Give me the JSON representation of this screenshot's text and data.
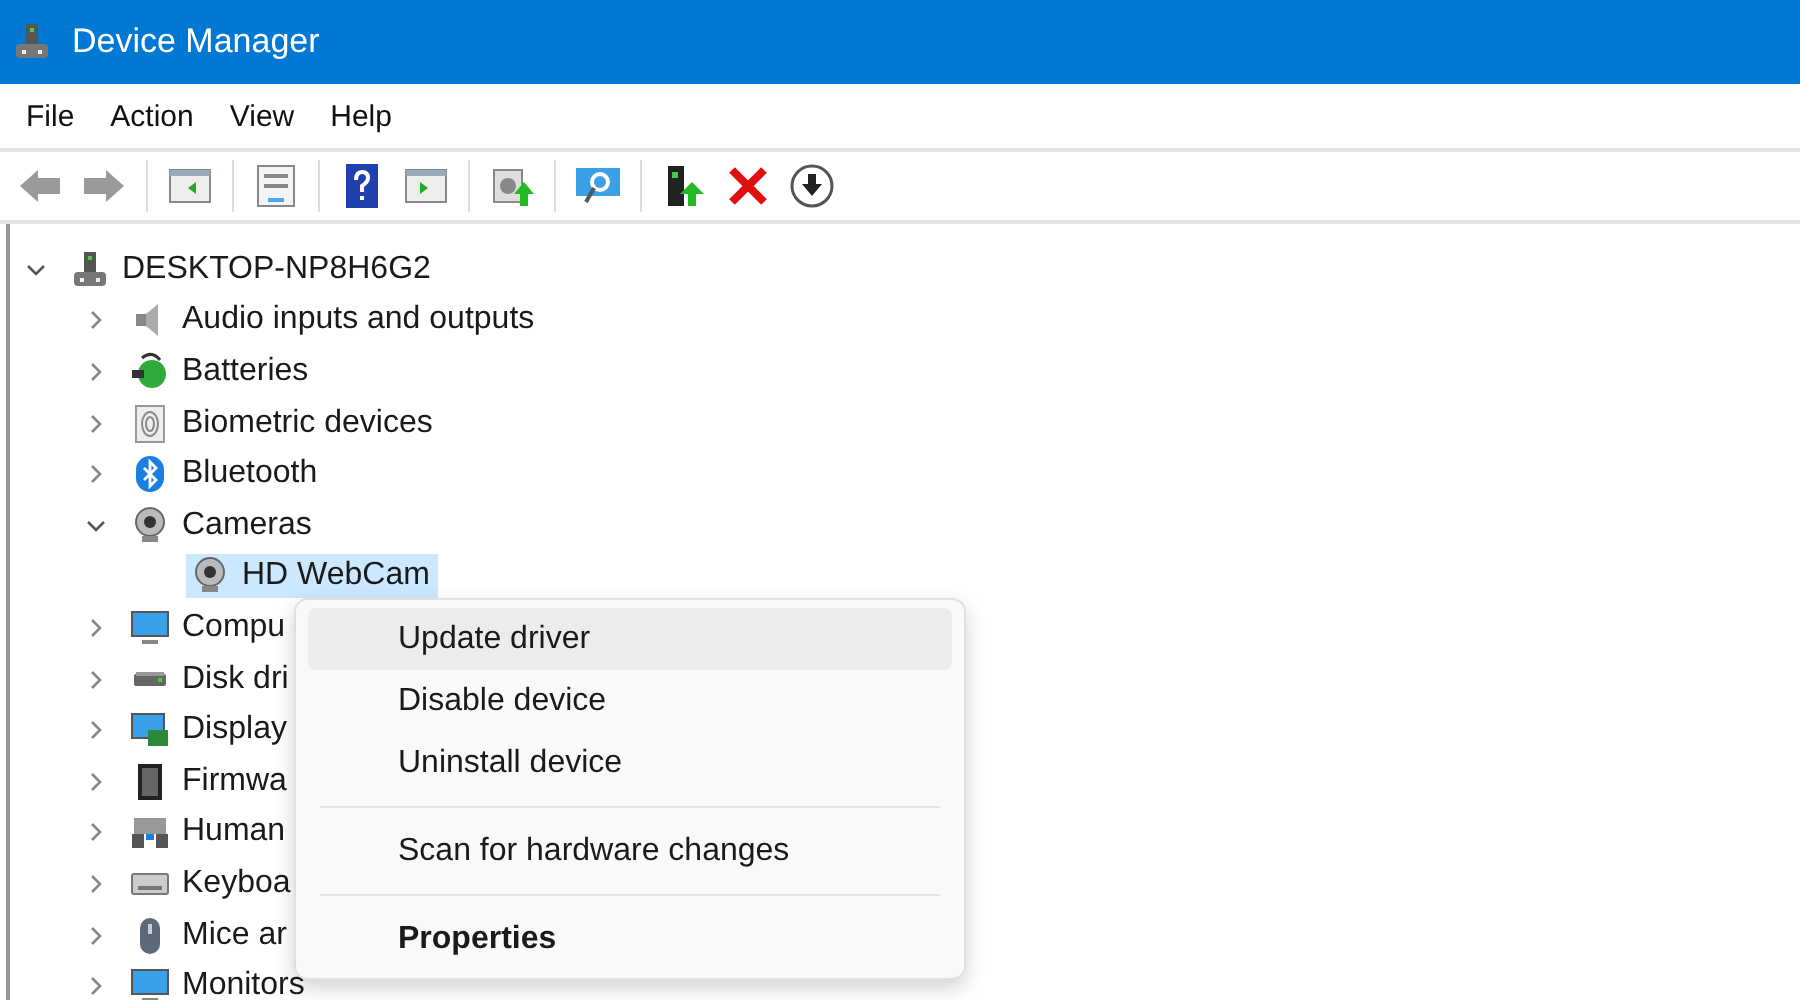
{
  "window": {
    "title": "Device Manager"
  },
  "menu_bar": [
    "File",
    "Action",
    "View",
    "Help"
  ],
  "toolbar": [
    {
      "kind": "back",
      "disabled": true
    },
    {
      "kind": "forward",
      "disabled": true
    },
    {
      "kind": "sep"
    },
    {
      "kind": "tree-pane"
    },
    {
      "kind": "sep"
    },
    {
      "kind": "properties"
    },
    {
      "kind": "sep"
    },
    {
      "kind": "help"
    },
    {
      "kind": "action-pane"
    },
    {
      "kind": "sep"
    },
    {
      "kind": "update"
    },
    {
      "kind": "sep"
    },
    {
      "kind": "scan"
    },
    {
      "kind": "sep"
    },
    {
      "kind": "enable"
    },
    {
      "kind": "uninstall"
    },
    {
      "kind": "download"
    }
  ],
  "tree": {
    "label": "DESKTOP-NP8H6G2",
    "kind": "computer",
    "expanded": true,
    "selected": false,
    "children": [
      {
        "label": "Audio inputs and outputs",
        "kind": "speaker",
        "expanded": false,
        "selected": false
      },
      {
        "label": "Batteries",
        "kind": "battery",
        "expanded": false,
        "selected": false
      },
      {
        "label": "Biometric devices",
        "kind": "fingerprint",
        "expanded": false,
        "selected": false
      },
      {
        "label": "Bluetooth",
        "kind": "bluetooth",
        "expanded": false,
        "selected": false
      },
      {
        "label": "Cameras",
        "kind": "camera",
        "expanded": true,
        "selected": false,
        "children": [
          {
            "label": "HD WebCam",
            "kind": "camera",
            "selected": true
          }
        ]
      },
      {
        "label": "Compu",
        "kind": "monitor",
        "expanded": false,
        "selected": false
      },
      {
        "label": "Disk dri",
        "kind": "disk",
        "expanded": false,
        "selected": false
      },
      {
        "label": "Display",
        "kind": "display",
        "expanded": false,
        "selected": false
      },
      {
        "label": "Firmwa",
        "kind": "chip",
        "expanded": false,
        "selected": false
      },
      {
        "label": "Human",
        "kind": "hid",
        "expanded": false,
        "selected": false
      },
      {
        "label": "Keyboa",
        "kind": "keyboard",
        "expanded": false,
        "selected": false
      },
      {
        "label": "Mice ar",
        "kind": "mouse",
        "expanded": false,
        "selected": false
      },
      {
        "label": "Monitors",
        "kind": "monitor",
        "expanded": false,
        "selected": false
      }
    ]
  },
  "context_menu": [
    {
      "kind": "item",
      "label": "Update driver",
      "selected": true,
      "default": false
    },
    {
      "kind": "item",
      "label": "Disable device",
      "selected": false,
      "default": false
    },
    {
      "kind": "item",
      "label": "Uninstall device",
      "selected": false,
      "default": false
    },
    {
      "kind": "separator"
    },
    {
      "kind": "item",
      "label": "Scan for hardware changes",
      "selected": false,
      "default": false
    },
    {
      "kind": "separator"
    },
    {
      "kind": "item",
      "label": "Properties",
      "selected": false,
      "default": true
    }
  ]
}
